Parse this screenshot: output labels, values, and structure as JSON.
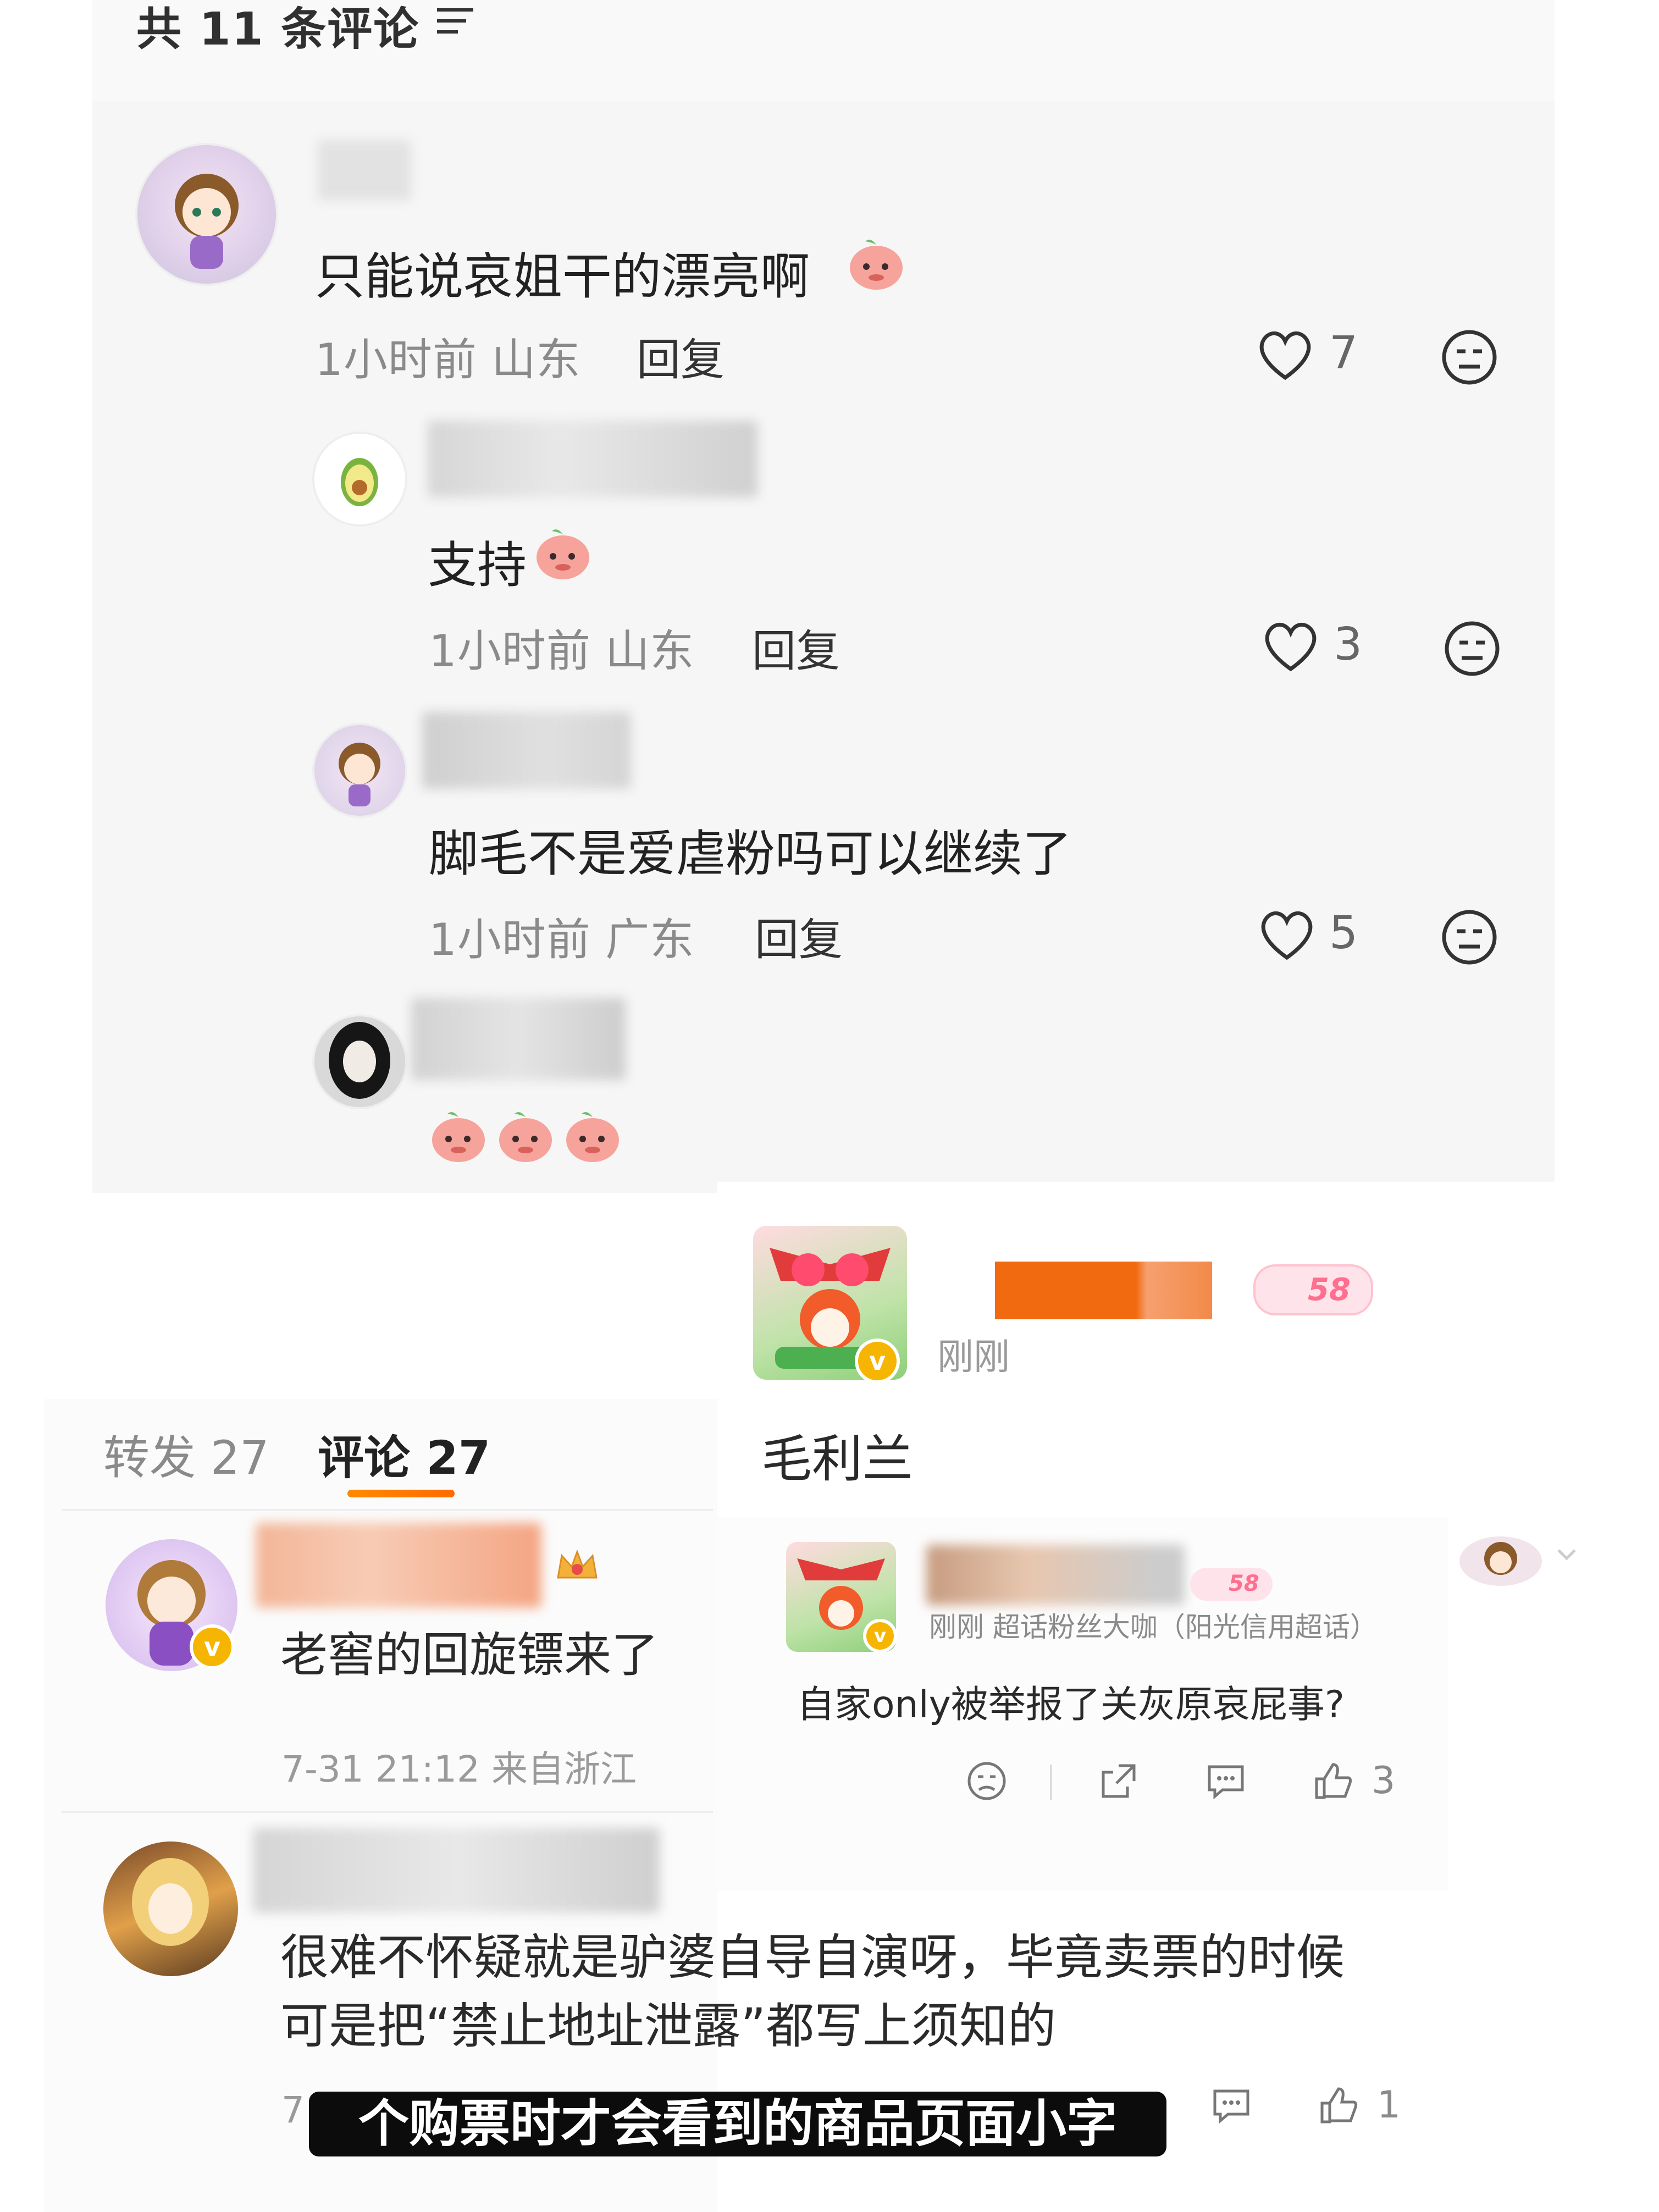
{
  "top_thread": {
    "comment_count_label": "共 11 条评论",
    "main_comment": {
      "text": "只能说哀姐干的漂亮啊",
      "time_location": "1小时前 山东",
      "reply_label": "回复",
      "likes": "7"
    },
    "replies": [
      {
        "text": "支持",
        "time_location": "1小时前 山东",
        "reply_label": "回复",
        "likes": "3"
      },
      {
        "text": "脚毛不是爱虐粉吗可以继续了",
        "time_location": "1小时前 广东",
        "reply_label": "回复",
        "likes": "5"
      }
    ]
  },
  "right_middle": {
    "time_label": "刚刚",
    "level_badge": "58",
    "name": "毛利兰"
  },
  "weibo_left": {
    "tabs": [
      {
        "label": "转发 27"
      },
      {
        "label": "评论 27"
      }
    ],
    "comments": [
      {
        "text": "老窖的回旋镖来了",
        "time": "7-31 21:12 来自浙江"
      },
      {
        "text_line1": "很难不怀疑就是驴婆自导自演呀，毕竟卖票的时候",
        "text_line2": "可是把“禁止地址泄露”都写上须知的",
        "time_prefix": "7"
      }
    ]
  },
  "weibo_right": {
    "meta": "刚刚  超话粉丝大咖（阳光信用超话）",
    "badge": "58",
    "text": "自家only被举报了关灰原哀屁事?",
    "likes": "3",
    "likes_2": "1"
  },
  "subtitle": "个购票时才会看到的商品页面小字",
  "colors": {
    "accent_orange": "#ff7a00",
    "verified_gold": "#f6b500"
  }
}
